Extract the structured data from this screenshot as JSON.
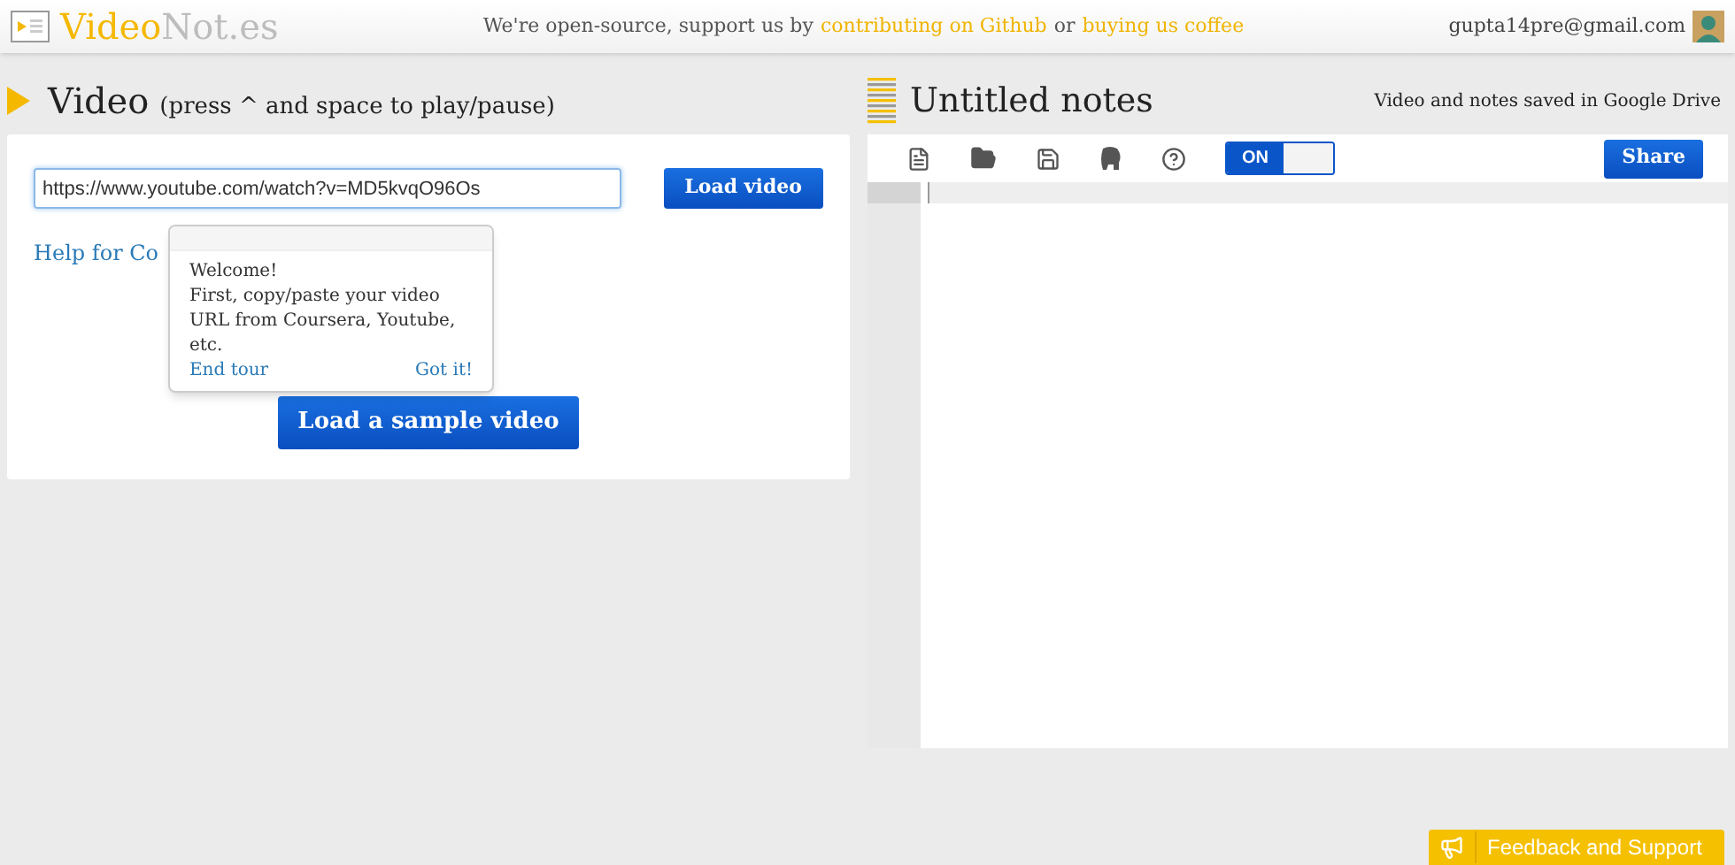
{
  "header": {
    "logo": {
      "prefix": "Video",
      "suffix": "Not.es"
    },
    "tagline": {
      "text": "We're open-source, support us by",
      "link1": "contributing on Github",
      "joiner": "or",
      "link2": "buying us coffee"
    },
    "user_email": "gupta14pre@gmail.com"
  },
  "video_panel": {
    "title": "Video",
    "hint": "(press ^ and space to play/pause)",
    "url_value": "https://www.youtube.com/watch?v=MD5kvqO96Os",
    "load_button": "Load video",
    "help_link": "Help for Co",
    "sample_button": "Load a sample video"
  },
  "tour_popover": {
    "lines": [
      "Welcome!",
      "First, copy/paste your video URL from Coursera, Youtube, etc."
    ],
    "end_link": "End tour",
    "ok_link": "Got it!"
  },
  "notes_panel": {
    "title": "Untitled notes",
    "status": "Video and notes saved in Google Drive",
    "toggle": {
      "label": "ON",
      "on": true
    },
    "share_button": "Share"
  },
  "feedback_button": "Feedback and Support"
}
